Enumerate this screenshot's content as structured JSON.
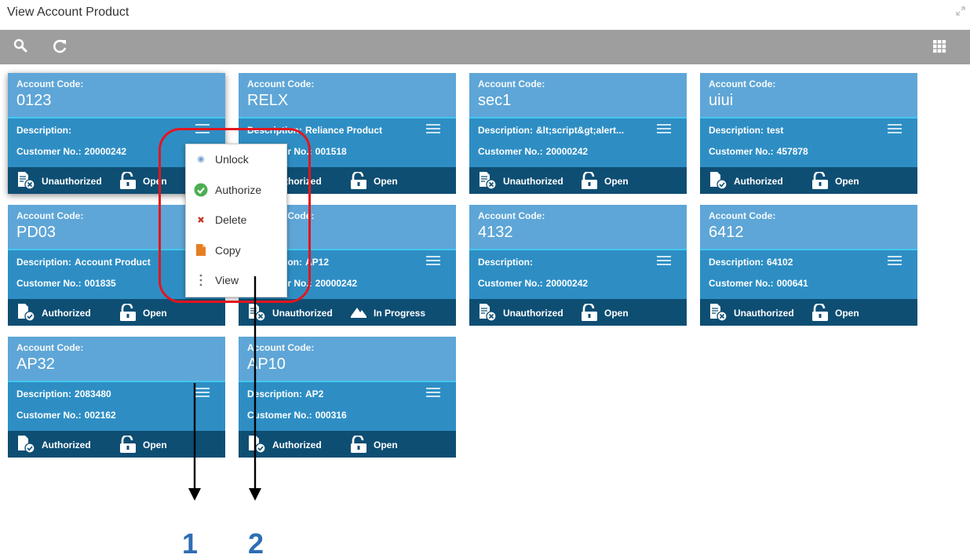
{
  "window": {
    "title": "View Account Product"
  },
  "toolbar": {
    "search_icon": "search-icon",
    "refresh_icon": "refresh-icon",
    "grid_icon": "grid-view-icon"
  },
  "labels": {
    "account_code": "Account Code:",
    "description": "Description:",
    "customer_no": "Customer No.:"
  },
  "cards": [
    {
      "code": "0123",
      "description": "",
      "customer_no": "20000242",
      "auth": "Unauthorized",
      "status": "Open"
    },
    {
      "code": "RELX",
      "description": "Reliance Product",
      "customer_no": "001518",
      "auth": "Authorized",
      "status": "Open"
    },
    {
      "code": "sec1",
      "description": "&lt;script&gt;alert...",
      "customer_no": "20000242",
      "auth": "Unauthorized",
      "status": "Open"
    },
    {
      "code": "uiui",
      "description": "test",
      "customer_no": "457878",
      "auth": "Authorized",
      "status": "Open"
    },
    {
      "code": "PD03",
      "description": "Account Product",
      "customer_no": "001835",
      "auth": "Authorized",
      "status": "Open"
    },
    {
      "code": "",
      "description": "AP12",
      "customer_no": "20000242",
      "auth": "Unauthorized",
      "status": "In Progress"
    },
    {
      "code": "4132",
      "description": "",
      "customer_no": "20000242",
      "auth": "Unauthorized",
      "status": "Open"
    },
    {
      "code": "6412",
      "description": "64102",
      "customer_no": "000641",
      "auth": "Unauthorized",
      "status": "Open"
    },
    {
      "code": "AP32",
      "description": "2083480",
      "customer_no": "002162",
      "auth": "Authorized",
      "status": "Open"
    },
    {
      "code": "AP10",
      "description": "AP2",
      "customer_no": "000316",
      "auth": "Authorized",
      "status": "Open"
    }
  ],
  "context_menu": {
    "items": [
      {
        "label": "Unlock",
        "icon": "unlock-dot-icon"
      },
      {
        "label": "Authorize",
        "icon": "check-circle-icon"
      },
      {
        "label": "Delete",
        "icon": "x-icon"
      },
      {
        "label": "Copy",
        "icon": "document-icon"
      },
      {
        "label": "View",
        "icon": "vertical-dots-icon"
      }
    ]
  },
  "annotations": {
    "callout_1": "1",
    "callout_2": "2"
  },
  "colors": {
    "card_top": "#5ea6d7",
    "card_mid": "#2e8ec4",
    "card_bottom": "#0e4e73",
    "highlight": "#e3151e",
    "callout": "#2e6db4"
  }
}
